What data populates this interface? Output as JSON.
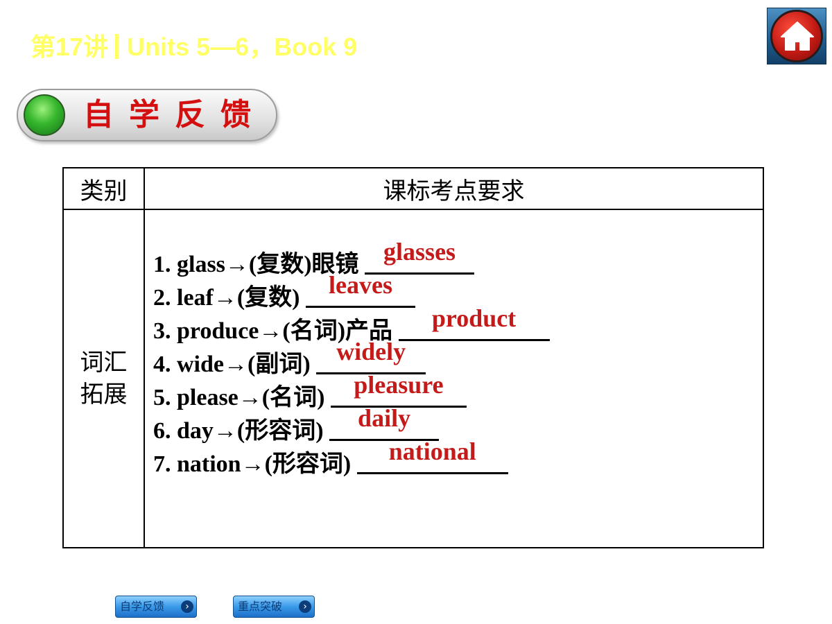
{
  "header": {
    "lesson": "第17讲",
    "title": "Units 5—6，Book 9"
  },
  "section": {
    "label": "自学反馈"
  },
  "table": {
    "headers": [
      "类别",
      "课标考点要求"
    ],
    "category": [
      "词汇",
      "拓展"
    ],
    "items": [
      {
        "prompt": "1. glass→(复数)眼镜 ",
        "answer": "glasses"
      },
      {
        "prompt": "2. leaf→(复数) ",
        "answer": "leaves"
      },
      {
        "prompt": "3. produce→(名词)产品 ",
        "answer": "product"
      },
      {
        "prompt": "4. wide→(副词) ",
        "answer": "widely"
      },
      {
        "prompt": "5. please→(名词) ",
        "answer": "pleasure"
      },
      {
        "prompt": "6. day→(形容词) ",
        "answer": "daily"
      },
      {
        "prompt": "7. nation→(形容词) ",
        "answer": "national"
      }
    ]
  },
  "nav": {
    "buttons": [
      {
        "label": "自学反馈",
        "icon": "chevron-right-icon"
      },
      {
        "label": "重点突破",
        "icon": "chevron-right-icon"
      }
    ]
  },
  "colors": {
    "title": "#ffff66",
    "answer": "#c41a1a",
    "section_label": "#d40f0f"
  }
}
